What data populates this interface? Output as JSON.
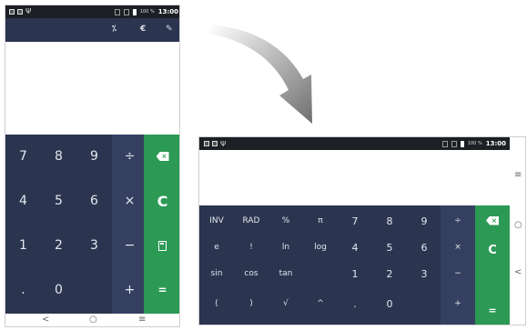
{
  "portrait": {
    "status": {
      "battery_pct": "100 %",
      "time": "13:00"
    },
    "toolbar": {
      "icon1": "⁒",
      "icon2": "€",
      "icon3": "✎"
    },
    "keys": {
      "r1": [
        "7",
        "8",
        "9",
        "÷"
      ],
      "r2": [
        "4",
        "5",
        "6",
        "×"
      ],
      "r3": [
        "1",
        "2",
        "3",
        "−"
      ],
      "r4": [
        ".",
        "0",
        "",
        "+"
      ],
      "clear": "C",
      "equals": "="
    },
    "nav": {
      "back": "<",
      "home": "○",
      "recents": "≡"
    }
  },
  "landscape": {
    "status": {
      "battery_pct": "100 %",
      "time": "13:00"
    },
    "rows": [
      [
        "INV",
        "RAD",
        "%",
        "π",
        "7",
        "8",
        "9",
        "÷"
      ],
      [
        "e",
        "!",
        "ln",
        "log",
        "4",
        "5",
        "6",
        "×"
      ],
      [
        "sin",
        "cos",
        "tan",
        "",
        "1",
        "2",
        "3",
        "−"
      ],
      [
        "(",
        ")",
        "√",
        "^",
        ".",
        "0",
        "",
        "+"
      ]
    ],
    "clear": "C",
    "equals": "=",
    "nav": {
      "recents": "≡",
      "home": "○",
      "back": "<"
    }
  },
  "colors": {
    "pad": "#2b3550",
    "ops": "#354060",
    "accent": "#2c9955"
  }
}
